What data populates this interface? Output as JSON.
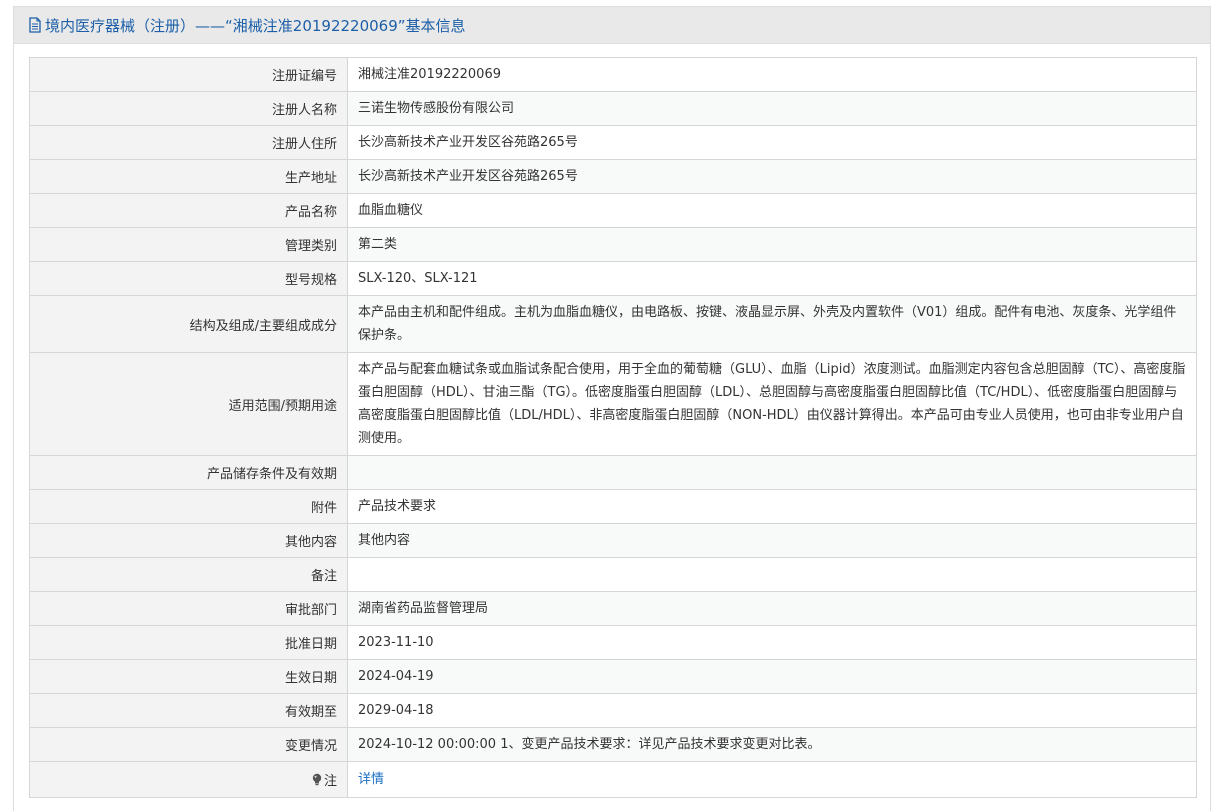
{
  "header": {
    "title": "境内医疗器械（注册）——“湘械注准20192220069”基本信息",
    "icon": "document-icon"
  },
  "rows": [
    {
      "label": "注册证编号",
      "value": "湘械注准20192220069"
    },
    {
      "label": "注册人名称",
      "value": "三诺生物传感股份有限公司"
    },
    {
      "label": "注册人住所",
      "value": "长沙高新技术产业开发区谷苑路265号"
    },
    {
      "label": "生产地址",
      "value": "长沙高新技术产业开发区谷苑路265号"
    },
    {
      "label": "产品名称",
      "value": "血脂血糖仪"
    },
    {
      "label": "管理类别",
      "value": "第二类"
    },
    {
      "label": "型号规格",
      "value": "SLX-120、SLX-121"
    },
    {
      "label": "结构及组成/主要组成成分",
      "value": "本产品由主机和配件组成。主机为血脂血糖仪，由电路板、按键、液晶显示屏、外壳及内置软件（V01）组成。配件有电池、灰度条、光学组件保护条。"
    },
    {
      "label": "适用范围/预期用途",
      "value": "本产品与配套血糖试条或血脂试条配合使用，用于全血的葡萄糖（GLU）、血脂（Lipid）浓度测试。血脂测定内容包含总胆固醇（TC）、高密度脂蛋白胆固醇（HDL）、甘油三酯（TG）。低密度脂蛋白胆固醇（LDL）、总胆固醇与高密度脂蛋白胆固醇比值（TC/HDL）、低密度脂蛋白胆固醇与高密度脂蛋白胆固醇比值（LDL/HDL）、非高密度脂蛋白胆固醇（NON-HDL）由仪器计算得出。本产品可由专业人员使用，也可由非专业用户自测使用。"
    },
    {
      "label": "产品储存条件及有效期",
      "value": ""
    },
    {
      "label": "附件",
      "value": "产品技术要求"
    },
    {
      "label": "其他内容",
      "value": "其他内容"
    },
    {
      "label": "备注",
      "value": ""
    },
    {
      "label": "审批部门",
      "value": "湖南省药品监督管理局"
    },
    {
      "label": "批准日期",
      "value": "2023-11-10"
    },
    {
      "label": "生效日期",
      "value": "2024-04-19"
    },
    {
      "label": "有效期至",
      "value": "2029-04-18"
    },
    {
      "label": "变更情况",
      "value": "2024-10-12 00:00:00 1、变更产品技术要求：详见产品技术要求变更对比表。"
    }
  ],
  "note": {
    "label": "注",
    "icon": "lightbulb-icon",
    "link": "详情"
  },
  "colors": {
    "header_text": "#1c5fa8",
    "link": "#1c6fc4",
    "header_bg": "#e9e9e9",
    "label_bg": "#f3f3f3"
  }
}
